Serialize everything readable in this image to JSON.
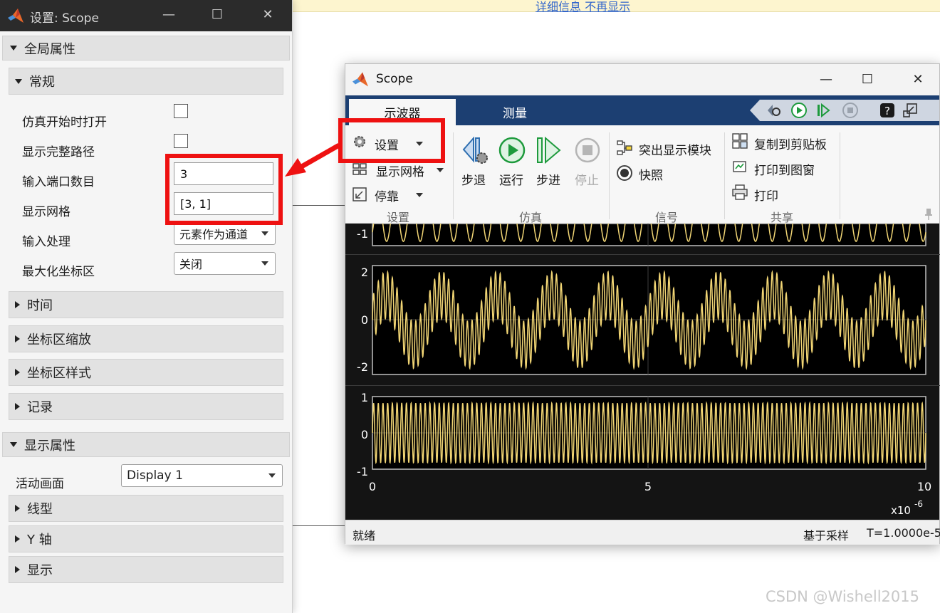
{
  "background": {
    "link_text": "详细信息 不再显示"
  },
  "settings_window": {
    "title": "设置: Scope",
    "global_props": "全局属性",
    "general": "常规",
    "open_at_start": "仿真开始时打开",
    "show_full_path": "显示完整路径",
    "num_input_ports_label": "输入端口数目",
    "num_input_ports_value": "3",
    "layout_label": "显示网格",
    "layout_value": "[3, 1]",
    "input_processing_label": "输入处理",
    "input_processing_value": "元素作为通道",
    "maximize_axes_label": "最大化坐标区",
    "maximize_axes_value": "关闭",
    "time": "时间",
    "axes_scaling": "坐标区缩放",
    "axes_style": "坐标区样式",
    "logging": "记录",
    "display_props": "显示属性",
    "active_display_label": "活动画面",
    "active_display_value": "Display 1",
    "line_style": "线型",
    "y_axis": "Y 轴",
    "display": "显示"
  },
  "scope_window": {
    "title": "Scope",
    "tabs": [
      "示波器",
      "测量"
    ],
    "ribbon": {
      "settings": "设置",
      "show_grid": "显示网格",
      "dock": "停靠",
      "step_back": "步退",
      "run": "运行",
      "step_forward": "步进",
      "stop": "停止",
      "highlight_block": "突出显示模块",
      "snapshot": "快照",
      "copy_clipboard": "复制到剪贴板",
      "print_figure": "打印到图窗",
      "print": "打印",
      "groups": [
        "设置",
        "仿真",
        "信号",
        "共享"
      ]
    },
    "plot": {
      "ax1_yticks": [
        "-1"
      ],
      "ax2_yticks": [
        "2",
        "0",
        "-2"
      ],
      "ax3_yticks": [
        "1",
        "0",
        "-1"
      ],
      "xticks": [
        "0",
        "5",
        "10"
      ],
      "x_multiplier": "x10",
      "x_exponent": "-6",
      "trace_color": "#f2d675"
    },
    "status": {
      "left": "就绪",
      "mid": "基于采样",
      "right": "T=1.0000e-5"
    }
  },
  "chart_data": {
    "type": "line",
    "x_range": [
      0,
      10
    ],
    "x_multiplier": "x10^-6",
    "axes": [
      {
        "ylim": [
          -1.2,
          1.2
        ],
        "series": "sine, partially visible"
      },
      {
        "ylim": [
          -2.2,
          2.2
        ],
        "series": "sum of low and high frequency sines"
      },
      {
        "ylim": [
          -1.1,
          1.1
        ],
        "series": "high frequency sine"
      }
    ],
    "grid": true
  },
  "watermark": "CSDN @Wishell2015"
}
